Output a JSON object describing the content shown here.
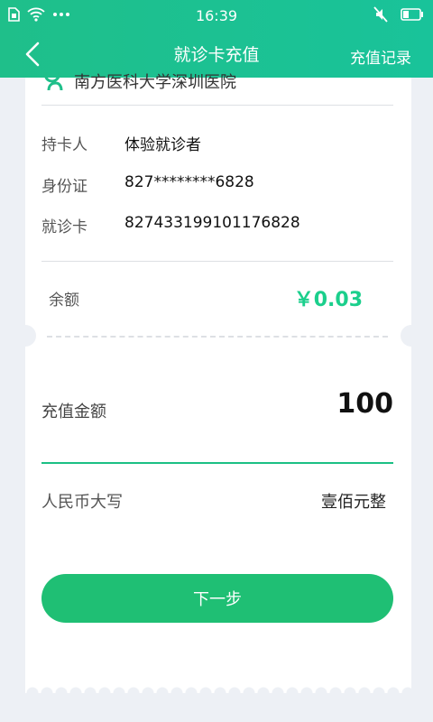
{
  "status_bar": {
    "time": "16:39",
    "icons": [
      "sim-icon",
      "wifi-icon",
      "more-dots-icon",
      "mute-icon",
      "battery-icon"
    ]
  },
  "nav": {
    "title": "就诊卡充值",
    "right_action": "充值记录",
    "back_icon": "back-chevron-icon"
  },
  "hospital": {
    "name": "南方医科大学深圳医院",
    "logo_icon": "hospital-logo-icon"
  },
  "card_info": [
    {
      "label": "持卡人",
      "value": "体验就诊者"
    },
    {
      "label": "身份证",
      "value": "827********6828"
    },
    {
      "label": "就诊卡",
      "value": "827433199101176828"
    }
  ],
  "balance": {
    "label": "余额",
    "value": "￥0.03"
  },
  "recharge": {
    "label": "充值金额",
    "amount": "100",
    "uppercase_label": "人民币大写",
    "uppercase_value": "壹佰元整"
  },
  "next_button": "下一步",
  "colors": {
    "brand": "#1fbf8a",
    "accent_green": "#1bcf8c",
    "button": "#1fbf74"
  }
}
